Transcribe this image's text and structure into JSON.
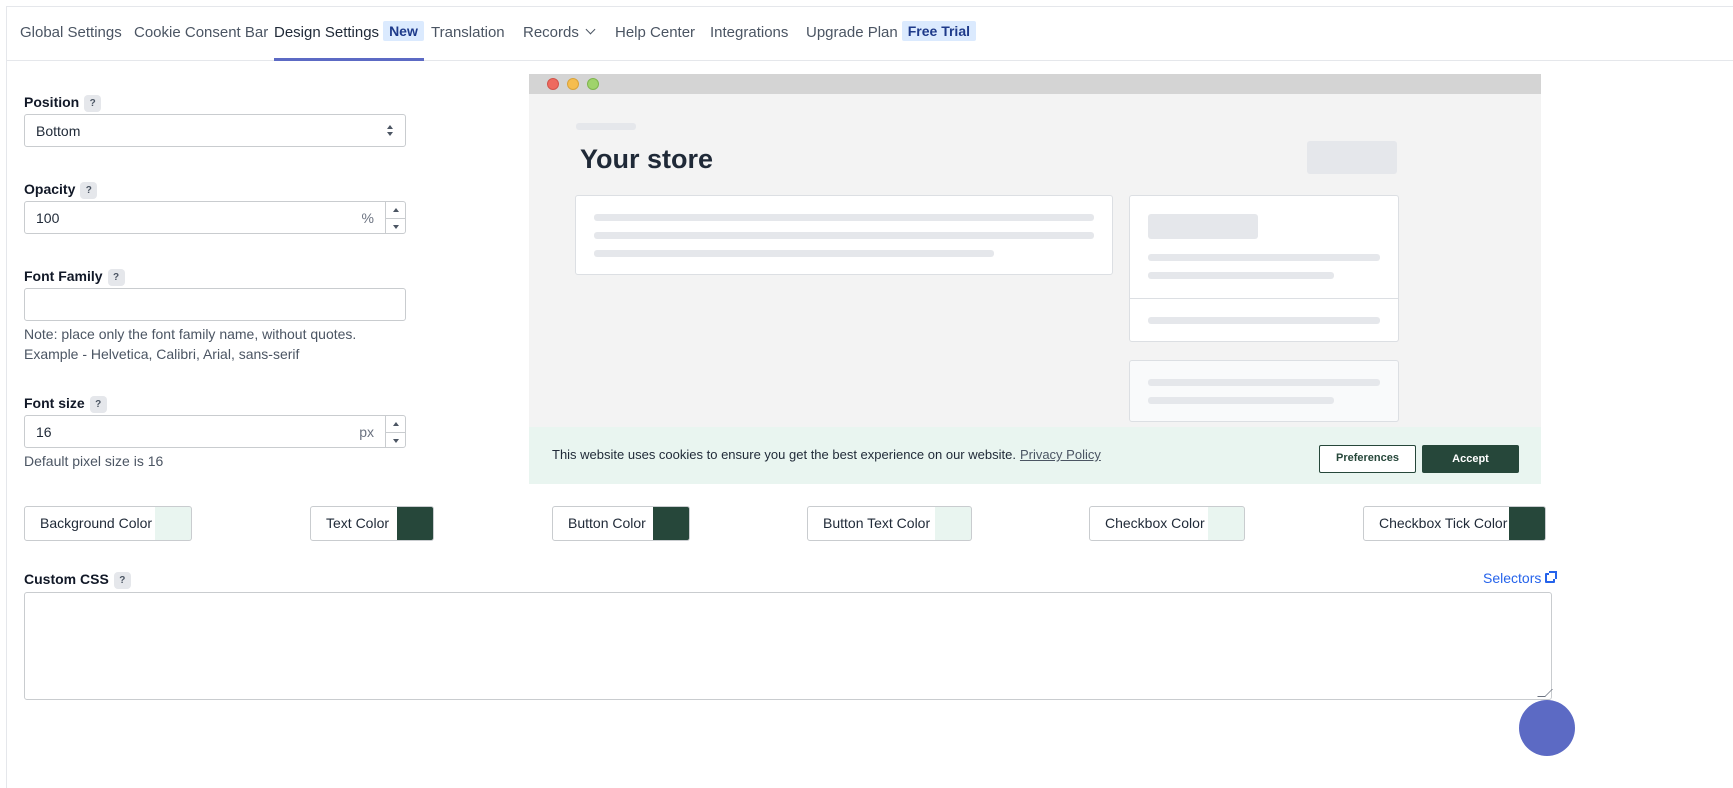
{
  "nav": {
    "tabs": [
      {
        "label": "Global Settings"
      },
      {
        "label": "Cookie Consent Bar"
      },
      {
        "label": "Design Settings",
        "badge": "New"
      },
      {
        "label": "Translation"
      },
      {
        "label": "Records"
      },
      {
        "label": "Help Center"
      },
      {
        "label": "Integrations"
      },
      {
        "label": "Upgrade Plan",
        "badge": "Free Trial"
      }
    ]
  },
  "form": {
    "position": {
      "label": "Position",
      "help": "?",
      "value": "Bottom"
    },
    "opacity": {
      "label": "Opacity",
      "help": "?",
      "value": "100",
      "unit": "%"
    },
    "font_family": {
      "label": "Font Family",
      "help": "?",
      "value": "",
      "note": "Note: place only the font family name, without quotes. Example - Helvetica, Calibri, Arial, sans-serif"
    },
    "font_size": {
      "label": "Font size",
      "help": "?",
      "value": "16",
      "unit": "px",
      "note": "Default pixel size is 16"
    }
  },
  "preview": {
    "store_title": "Your store",
    "cookie_text": "This website uses cookies to ensure you get the best experience on our website.",
    "privacy_link": "Privacy Policy",
    "preferences_label": "Preferences",
    "accept_label": "Accept"
  },
  "colors": [
    {
      "label": "Background Color",
      "value": "#e9f5f0"
    },
    {
      "label": "Text Color",
      "value": "#26473a"
    },
    {
      "label": "Button Color",
      "value": "#26473a"
    },
    {
      "label": "Button Text Color",
      "value": "#e9f5f0"
    },
    {
      "label": "Checkbox Color",
      "value": "#e9f5f0"
    },
    {
      "label": "Checkbox Tick Color",
      "value": "#26473a"
    }
  ],
  "custom_css": {
    "label": "Custom CSS",
    "help": "?",
    "selectors_label": "Selectors",
    "value": ""
  }
}
